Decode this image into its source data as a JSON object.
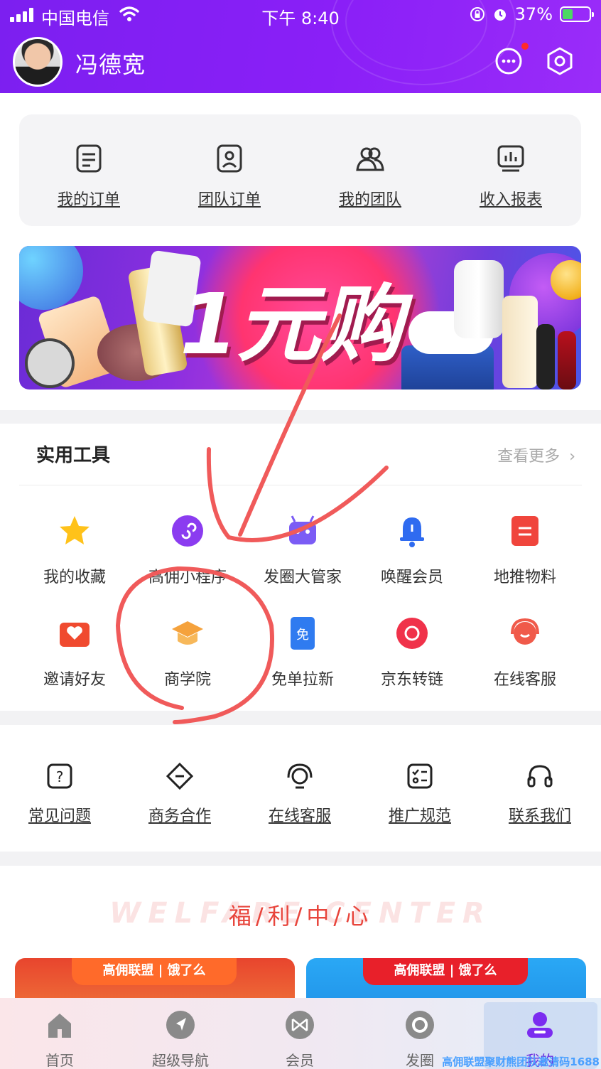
{
  "status_bar": {
    "carrier": "中国电信",
    "time": "下午 8:40",
    "battery": "37%",
    "battery_level": 0.37
  },
  "header": {
    "username": "冯德宽",
    "message_has_dot": true
  },
  "orders": {
    "items": [
      {
        "label": "我的订单",
        "icon": "order-list-icon"
      },
      {
        "label": "团队订单",
        "icon": "team-order-icon"
      },
      {
        "label": "我的团队",
        "icon": "team-icon"
      },
      {
        "label": "收入报表",
        "icon": "report-chart-icon"
      }
    ]
  },
  "banner": {
    "title": "1元购"
  },
  "tools": {
    "title": "实用工具",
    "more": "查看更多",
    "items": [
      {
        "label": "我的收藏",
        "icon": "star-icon",
        "color": "#ffc21a"
      },
      {
        "label": "高佣小程序",
        "icon": "mini-program-icon",
        "color": "#8b3cf0"
      },
      {
        "label": "发圈大管家",
        "icon": "robot-icon",
        "color": "#7b5cf5"
      },
      {
        "label": "唤醒会员",
        "icon": "bell-icon",
        "color": "#2f6bf0"
      },
      {
        "label": "地推物料",
        "icon": "document-icon",
        "color": "#f0453c"
      },
      {
        "label": "邀请好友",
        "icon": "heart-envelope-icon",
        "color": "#f04a2f"
      },
      {
        "label": "商学院",
        "icon": "graduation-cap-icon",
        "color": "#f5a23c"
      },
      {
        "label": "免单拉新",
        "icon": "ticket-icon",
        "color": "#2f7bf0"
      },
      {
        "label": "京东转链",
        "icon": "link-icon",
        "color": "#f0324a"
      },
      {
        "label": "在线客服",
        "icon": "headset-icon",
        "color": "#f05a4a"
      }
    ]
  },
  "help": {
    "items": [
      {
        "label": "常见问题",
        "icon": "question-icon"
      },
      {
        "label": "商务合作",
        "icon": "handshake-icon"
      },
      {
        "label": "在线客服",
        "icon": "customer-service-icon"
      },
      {
        "label": "推广规范",
        "icon": "checklist-icon"
      },
      {
        "label": "联系我们",
        "icon": "earphone-icon"
      }
    ]
  },
  "welfare": {
    "bg_text": "WELFARE CENTER",
    "title": "福/利/中/心",
    "coupons": [
      {
        "label": "高佣联盟 | 饿了么",
        "color": "#e8452e"
      },
      {
        "label": "高佣联盟 | 饿了么",
        "color": "#2aa8f5"
      }
    ]
  },
  "tabbar": {
    "items": [
      {
        "label": "首页",
        "icon": "home-icon"
      },
      {
        "label": "超级导航",
        "icon": "navigation-icon"
      },
      {
        "label": "会员",
        "icon": "member-icon"
      },
      {
        "label": "发圈",
        "icon": "circle-icon"
      },
      {
        "label": "我的",
        "icon": "profile-icon"
      }
    ],
    "active_index": 4,
    "watermark": "高佣联盟聚财熊团队邀请码1688"
  }
}
